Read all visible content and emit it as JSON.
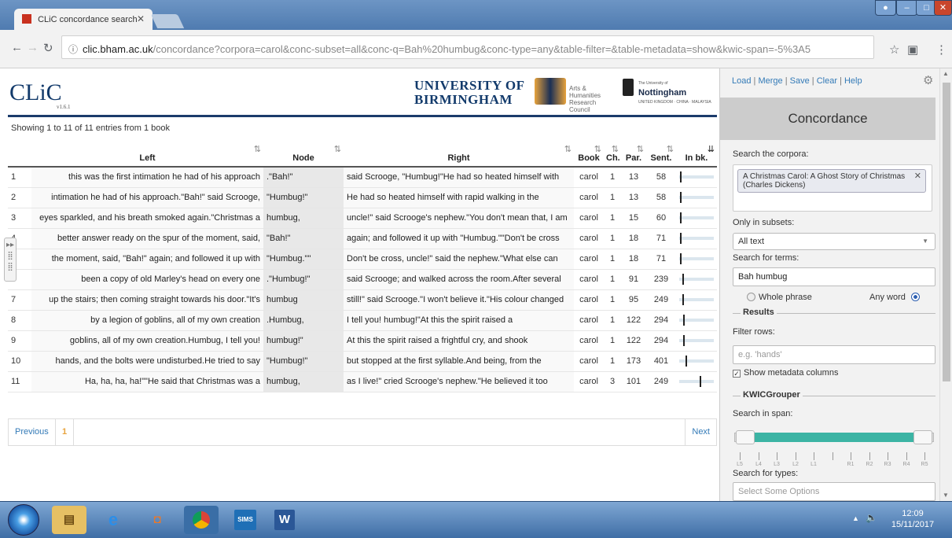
{
  "browser": {
    "tab_title": "CLiC concordance search",
    "url_scheme": "clic.bham.ac.uk",
    "url_path": "/concordance?corpora=carol&conc-subset=all&conc-q=Bah%20humbug&conc-type=any&table-filter=&table-metadata=show&kwic-span=-5%3A5"
  },
  "brand": {
    "logo": "CLiC",
    "version": "v1.6.1",
    "university": "UNIVERSITY OF BIRMINGHAM",
    "ahrc": "Arts & Humanities Research Council",
    "nottingham_small": "The University of",
    "nottingham": "Nottingham",
    "nottingham_sub": "UNITED KINGDOM · CHINA · MALAYSIA"
  },
  "results": {
    "summary": "Showing 1 to 11 of 11 entries from 1 book",
    "columns": [
      "",
      "Left",
      "Node",
      "Right",
      "Book",
      "Ch.",
      "Par.",
      "Sent.",
      "In bk."
    ],
    "rows": [
      {
        "idx": "1",
        "left": "this was the first intimation he had of his approach",
        "node": ".\"Bah!\"",
        "right": "said Scrooge, \"Humbug!\"He had so heated himself with",
        "book": "carol",
        "ch": "1",
        "par": "13",
        "sent": "58",
        "pos": 0.02
      },
      {
        "idx": "2",
        "left": "intimation he had of his approach.\"Bah!\" said Scrooge,",
        "node": "\"Humbug!\"",
        "right": "He had so heated himself with rapid walking in the",
        "book": "carol",
        "ch": "1",
        "par": "13",
        "sent": "58",
        "pos": 0.02
      },
      {
        "idx": "3",
        "left": "eyes sparkled, and his breath smoked again.\"Christmas a",
        "node": "humbug,",
        "right": "uncle!\" said Scrooge's nephew.\"You don't mean that, I am",
        "book": "carol",
        "ch": "1",
        "par": "15",
        "sent": "60",
        "pos": 0.03
      },
      {
        "idx": "4",
        "left": "better answer ready on the spur of the moment, said,",
        "node": "\"Bah!\"",
        "right": "again; and followed it up with \"Humbug.\"\"Don't be cross",
        "book": "carol",
        "ch": "1",
        "par": "18",
        "sent": "71",
        "pos": 0.03
      },
      {
        "idx": "5",
        "left": "the moment, said, \"Bah!\" again; and followed it up with",
        "node": "\"Humbug.\"\"",
        "right": "Don't be cross, uncle!\" said the nephew.\"What else can",
        "book": "carol",
        "ch": "1",
        "par": "18",
        "sent": "71",
        "pos": 0.03
      },
      {
        "idx": "6",
        "left": "been a copy of old Marley's head on every one",
        "node": ".\"Humbug!\"",
        "right": "said Scrooge; and walked across the room.After several",
        "book": "carol",
        "ch": "1",
        "par": "91",
        "sent": "239",
        "pos": 0.1
      },
      {
        "idx": "7",
        "left": "up the stairs; then coming straight towards his door.\"It's",
        "node": "humbug",
        "right": "still!\" said Scrooge.\"I won't believe it.\"His colour changed",
        "book": "carol",
        "ch": "1",
        "par": "95",
        "sent": "249",
        "pos": 0.1
      },
      {
        "idx": "8",
        "left": "by a legion of goblins, all of my own creation",
        "node": ".Humbug,",
        "right": "I tell you! humbug!\"At this the spirit raised a",
        "book": "carol",
        "ch": "1",
        "par": "122",
        "sent": "294",
        "pos": 0.13
      },
      {
        "idx": "9",
        "left": "goblins, all of my own creation.Humbug, I tell you!",
        "node": "humbug!\"",
        "right": "At this the spirit raised a frightful cry, and shook",
        "book": "carol",
        "ch": "1",
        "par": "122",
        "sent": "294",
        "pos": 0.13
      },
      {
        "idx": "10",
        "left": "hands, and the bolts were undisturbed.He tried to say",
        "node": "\"Humbug!\"",
        "right": "but stopped at the first syllable.And being, from the",
        "book": "carol",
        "ch": "1",
        "par": "173",
        "sent": "401",
        "pos": 0.18
      },
      {
        "idx": "11",
        "left": "Ha, ha, ha, ha!\"\"He said that Christmas was a",
        "node": "humbug,",
        "right": "as I live!\" cried Scrooge's nephew.\"He believed it too",
        "book": "carol",
        "ch": "3",
        "par": "101",
        "sent": "249",
        "pos": 0.62
      }
    ]
  },
  "pager": {
    "previous": "Previous",
    "page": "1",
    "next": "Next"
  },
  "panel": {
    "load": "Load",
    "merge": "Merge",
    "save": "Save",
    "clear": "Clear",
    "help": "Help",
    "title": "Concordance",
    "search_corpora_label": "Search the corpora:",
    "corpus_chip": "A Christmas Carol: A Ghost Story of Christmas (Charles Dickens)",
    "subsets_label": "Only in subsets:",
    "subset_value": "All text",
    "terms_label": "Search for terms:",
    "terms_value": "Bah humbug",
    "whole_phrase": "Whole phrase",
    "any_word": "Any word",
    "results_legend": "Results",
    "filter_label": "Filter rows:",
    "filter_placeholder": "e.g. 'hands'",
    "show_metadata": "Show metadata columns",
    "kwic_legend": "KWICGrouper",
    "span_label": "Search in span:",
    "span_ticks": [
      "L5",
      "L4",
      "L3",
      "L2",
      "L1",
      "",
      "R1",
      "R2",
      "R3",
      "R4",
      "R5"
    ],
    "types_label": "Search for types:",
    "types_placeholder": "Select Some Options"
  },
  "taskbar": {
    "clock_time": "12:09",
    "clock_date": "15/11/2017",
    "sims": "SIMS"
  },
  "colors": {
    "accent": "#337ab7",
    "teal": "#3cb4a4",
    "navy": "#123a6b"
  }
}
